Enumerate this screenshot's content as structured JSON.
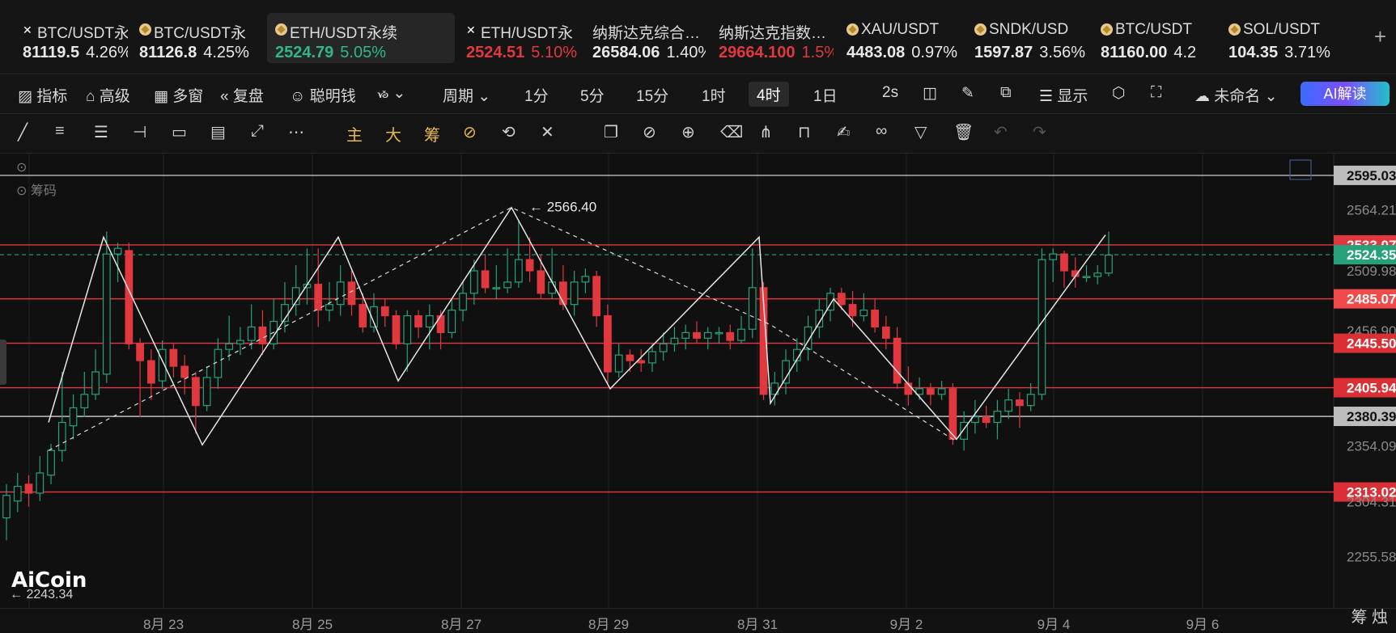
{
  "tabs": [
    {
      "icon": "x-icon",
      "name": "BTC/USDT永",
      "price": "81119.5",
      "pct": "4.26%",
      "trend": "neutral"
    },
    {
      "icon": "coin-icon",
      "name": "BTC/USDT永",
      "price": "81126.8",
      "pct": "4.25%",
      "trend": "neutral"
    },
    {
      "icon": "coin-icon",
      "name": "ETH/USDT永续",
      "price": "2524.79",
      "pct": "5.05%",
      "trend": "up",
      "active": true
    },
    {
      "icon": "x-icon",
      "name": "ETH/USDT永",
      "price": "2524.51",
      "pct": "5.10%",
      "trend": "down"
    },
    {
      "icon": "",
      "name": "纳斯达克综合…",
      "price": "26584.06",
      "pct": "1.40%",
      "trend": "neutral"
    },
    {
      "icon": "",
      "name": "纳斯达克指数…",
      "price": "29664.100",
      "pct": "1.5%",
      "trend": "down"
    },
    {
      "icon": "coin-icon",
      "name": "XAU/USDT",
      "price": "4483.08",
      "pct": "0.97%",
      "trend": "neutral"
    },
    {
      "icon": "coin-icon",
      "name": "SNDK/USD",
      "price": "1597.87",
      "pct": "3.56%",
      "trend": "neutral"
    },
    {
      "icon": "coin-icon",
      "name": "BTC/USDT",
      "price": "81160.00",
      "pct": "4.2",
      "trend": "neutral"
    },
    {
      "icon": "coin-icon",
      "name": "SOL/USDT",
      "price": "104.35",
      "pct": "3.71%",
      "trend": "neutral"
    }
  ],
  "toolbar": {
    "indicator": "指标",
    "advanced": "高级",
    "multi": "多窗",
    "replay": "复盘",
    "smart": "聪明钱",
    "period": "周期",
    "i1m": "1分",
    "i5m": "5分",
    "i15m": "15分",
    "i1h": "1时",
    "i4h": "4时",
    "i1d": "1日",
    "refresh": "2s",
    "display": "显示",
    "layout_name": "未命名",
    "ai": "AI解读"
  },
  "drawtools": {
    "main": "主",
    "big": "大",
    "chips": "筹"
  },
  "chart": {
    "chips_label": "筹码",
    "peak_label": "2566.40",
    "price_labels": [
      {
        "text": "2595.03",
        "y": 2595.03,
        "bg": "#bdbdbd",
        "fg": "#101010"
      },
      {
        "text": "2564.21",
        "y": 2564.21,
        "bg": "",
        "fg": "#8a8a8a"
      },
      {
        "text": "2533.07",
        "y": 2533.07,
        "bg": "#e0383e",
        "fg": "#ffffff"
      },
      {
        "text": "2524.35",
        "y": 2524.35,
        "bg": "#26a17b",
        "fg": "#ffffff"
      },
      {
        "text": "2509.98",
        "y": 2509.98,
        "bg": "",
        "fg": "#8a8a8a"
      },
      {
        "text": "2485.07",
        "y": 2485.07,
        "bg": "#f04a4a",
        "fg": "#ffffff"
      },
      {
        "text": "2456.90",
        "y": 2456.9,
        "bg": "",
        "fg": "#8a8a8a"
      },
      {
        "text": "2445.50",
        "y": 2445.5,
        "bg": "#d92f35",
        "fg": "#ffffff"
      },
      {
        "text": "2405.94",
        "y": 2405.94,
        "bg": "#d92f35",
        "fg": "#ffffff"
      },
      {
        "text": "2380.39",
        "y": 2380.39,
        "bg": "#bdbdbd",
        "fg": "#101010"
      },
      {
        "text": "2354.09",
        "y": 2354.09,
        "bg": "",
        "fg": "#8a8a8a"
      },
      {
        "text": "2313.02",
        "y": 2313.02,
        "bg": "#d92f35",
        "fg": "#ffffff"
      },
      {
        "text": "2304.31",
        "y": 2304.31,
        "bg": "",
        "fg": "#8a8a8a"
      },
      {
        "text": "2255.58",
        "y": 2255.58,
        "bg": "",
        "fg": "#8a8a8a"
      }
    ],
    "low_label": "2243.34",
    "x_labels": [
      "8月 23",
      "8月 25",
      "8月 27",
      "8月 29",
      "8月 31",
      "9月 2",
      "9月 4",
      "9月 6"
    ],
    "logo": "AiCoin",
    "corner": "筹 烛"
  },
  "chart_data": {
    "type": "candlestick",
    "pair": "ETH/USDT永续",
    "interval": "4时",
    "ylim": [
      2240,
      2600
    ],
    "h_lines": [
      {
        "y": 2595.03,
        "color": "#bdbdbd"
      },
      {
        "y": 2533.07,
        "color": "#e0383e"
      },
      {
        "y": 2485.07,
        "color": "#e0383e"
      },
      {
        "y": 2445.5,
        "color": "#e0383e"
      },
      {
        "y": 2405.94,
        "color": "#e0383e"
      },
      {
        "y": 2380.39,
        "color": "#cfcfcf"
      },
      {
        "y": 2313.02,
        "color": "#e0383e"
      }
    ],
    "last_price": 2524.35,
    "candles": [
      [
        2290,
        2310,
        2270,
        2320
      ],
      [
        2305,
        2318,
        2295,
        2330
      ],
      [
        2320,
        2312,
        2300,
        2328
      ],
      [
        2312,
        2330,
        2305,
        2345
      ],
      [
        2328,
        2350,
        2320,
        2356
      ],
      [
        2350,
        2375,
        2340,
        2420
      ],
      [
        2372,
        2388,
        2360,
        2400
      ],
      [
        2388,
        2400,
        2380,
        2420
      ],
      [
        2400,
        2420,
        2395,
        2440
      ],
      [
        2418,
        2525,
        2410,
        2545
      ],
      [
        2525,
        2530,
        2500,
        2535
      ],
      [
        2528,
        2445,
        2440,
        2535
      ],
      [
        2445,
        2430,
        2380,
        2450
      ],
      [
        2430,
        2410,
        2395,
        2440
      ],
      [
        2412,
        2440,
        2405,
        2448
      ],
      [
        2440,
        2425,
        2415,
        2445
      ],
      [
        2425,
        2415,
        2400,
        2435
      ],
      [
        2415,
        2390,
        2365,
        2420
      ],
      [
        2390,
        2415,
        2385,
        2425
      ],
      [
        2415,
        2440,
        2405,
        2450
      ],
      [
        2440,
        2445,
        2430,
        2470
      ],
      [
        2445,
        2448,
        2435,
        2460
      ],
      [
        2448,
        2460,
        2440,
        2480
      ],
      [
        2460,
        2445,
        2435,
        2475
      ],
      [
        2445,
        2465,
        2440,
        2485
      ],
      [
        2465,
        2480,
        2455,
        2500
      ],
      [
        2480,
        2495,
        2470,
        2515
      ],
      [
        2495,
        2498,
        2480,
        2530
      ],
      [
        2498,
        2475,
        2460,
        2530
      ],
      [
        2475,
        2480,
        2465,
        2500
      ],
      [
        2480,
        2500,
        2470,
        2515
      ],
      [
        2500,
        2480,
        2470,
        2510
      ],
      [
        2480,
        2460,
        2455,
        2490
      ],
      [
        2460,
        2478,
        2455,
        2490
      ],
      [
        2478,
        2470,
        2460,
        2485
      ],
      [
        2470,
        2445,
        2440,
        2475
      ],
      [
        2445,
        2470,
        2420,
        2475
      ],
      [
        2470,
        2460,
        2450,
        2475
      ],
      [
        2460,
        2470,
        2440,
        2480
      ],
      [
        2470,
        2455,
        2440,
        2475
      ],
      [
        2455,
        2475,
        2450,
        2485
      ],
      [
        2475,
        2490,
        2465,
        2500
      ],
      [
        2490,
        2510,
        2480,
        2520
      ],
      [
        2510,
        2495,
        2490,
        2525
      ],
      [
        2495,
        2495,
        2485,
        2515
      ],
      [
        2495,
        2500,
        2490,
        2530
      ],
      [
        2500,
        2520,
        2495,
        2555
      ],
      [
        2520,
        2510,
        2500,
        2540
      ],
      [
        2510,
        2490,
        2485,
        2525
      ],
      [
        2490,
        2500,
        2485,
        2530
      ],
      [
        2500,
        2480,
        2475,
        2515
      ],
      [
        2480,
        2500,
        2470,
        2510
      ],
      [
        2500,
        2505,
        2490,
        2512
      ],
      [
        2505,
        2470,
        2460,
        2510
      ],
      [
        2470,
        2420,
        2410,
        2480
      ],
      [
        2420,
        2435,
        2415,
        2445
      ],
      [
        2435,
        2430,
        2420,
        2440
      ],
      [
        2430,
        2428,
        2420,
        2440
      ],
      [
        2428,
        2438,
        2420,
        2445
      ],
      [
        2438,
        2445,
        2430,
        2455
      ],
      [
        2445,
        2450,
        2438,
        2460
      ],
      [
        2450,
        2455,
        2440,
        2462
      ],
      [
        2455,
        2450,
        2445,
        2465
      ],
      [
        2450,
        2455,
        2440,
        2460
      ],
      [
        2455,
        2455,
        2445,
        2460
      ],
      [
        2455,
        2448,
        2440,
        2462
      ],
      [
        2448,
        2458,
        2445,
        2470
      ],
      [
        2458,
        2495,
        2450,
        2530
      ],
      [
        2495,
        2400,
        2395,
        2500
      ],
      [
        2400,
        2410,
        2390,
        2420
      ],
      [
        2410,
        2430,
        2400,
        2440
      ],
      [
        2430,
        2440,
        2420,
        2450
      ],
      [
        2440,
        2460,
        2430,
        2470
      ],
      [
        2460,
        2475,
        2450,
        2485
      ],
      [
        2475,
        2490,
        2465,
        2495
      ],
      [
        2490,
        2480,
        2475,
        2495
      ],
      [
        2480,
        2470,
        2460,
        2492
      ],
      [
        2470,
        2475,
        2465,
        2490
      ],
      [
        2475,
        2460,
        2455,
        2485
      ],
      [
        2460,
        2450,
        2440,
        2470
      ],
      [
        2450,
        2410,
        2405,
        2460
      ],
      [
        2410,
        2400,
        2390,
        2425
      ],
      [
        2400,
        2405,
        2395,
        2415
      ],
      [
        2405,
        2400,
        2390,
        2410
      ],
      [
        2400,
        2405,
        2395,
        2412
      ],
      [
        2405,
        2360,
        2355,
        2410
      ],
      [
        2360,
        2375,
        2350,
        2385
      ],
      [
        2375,
        2380,
        2365,
        2395
      ],
      [
        2380,
        2375,
        2370,
        2390
      ],
      [
        2375,
        2385,
        2360,
        2395
      ],
      [
        2385,
        2395,
        2378,
        2405
      ],
      [
        2395,
        2390,
        2370,
        2402
      ],
      [
        2390,
        2400,
        2385,
        2410
      ],
      [
        2400,
        2520,
        2395,
        2530
      ],
      [
        2520,
        2525,
        2500,
        2530
      ],
      [
        2525,
        2510,
        2495,
        2528
      ],
      [
        2510,
        2505,
        2495,
        2522
      ],
      [
        2505,
        2505,
        2500,
        2515
      ],
      [
        2505,
        2508,
        2498,
        2515
      ],
      [
        2508,
        2524,
        2505,
        2545
      ]
    ]
  }
}
